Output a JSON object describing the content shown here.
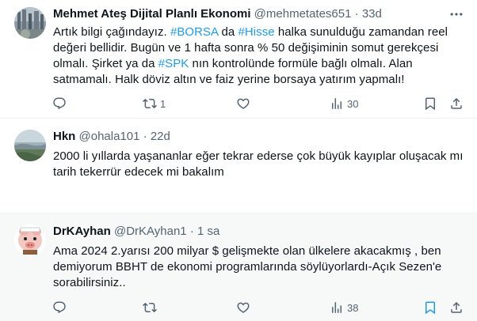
{
  "colors": {
    "accent": "#1d9bf0",
    "muted": "#536471",
    "text": "#0f1419",
    "highlight_bg": "#f7f9f9"
  },
  "tweets": [
    {
      "author": "Mehmet Ateş Dijital Planlı Ekonomi",
      "handle": "@mehmetates651",
      "separator": "·",
      "time": "33d",
      "body": [
        {
          "t": "Artık bilgi çağındayız. "
        },
        {
          "t": "#BORSA",
          "tag": true
        },
        {
          "t": " da "
        },
        {
          "t": "#Hisse",
          "tag": true
        },
        {
          "t": " halka sunulduğu zamandan reel değeri bellidir. Bugün ve 1 hafta sonra % 50 değişiminin somut gerekçesi olmalı. Şirket ya da "
        },
        {
          "t": "#SPK",
          "tag": true
        },
        {
          "t": " nın kontrolünde formüle bağlı olmalı. Alan satmamalı. Halk döviz altın ve faiz yerine borsaya yatırım yapmalı!"
        }
      ],
      "replies": "",
      "reposts": "1",
      "likes": "",
      "views": "30"
    },
    {
      "author": "Hkn",
      "handle": "@ohala101",
      "separator": "·",
      "time": "22d",
      "body": [
        {
          "t": "2000 li yıllarda yaşananlar eğer tekrar ederse çok büyük kayıplar oluşacak mı tarih tekerrür edecek mi bakalım"
        }
      ],
      "replies": "",
      "reposts": "",
      "likes": "",
      "views": ""
    },
    {
      "author": "DrKAyhan",
      "handle": "@DrKAyhan1",
      "separator": "·",
      "time": "1 sa",
      "body": [
        {
          "t": "Ama 2024 2.yarısı 200 milyar $ gelişmekte olan ülkelere akacakmış , ben demiyorum BBHT de ekonomi programlarında söylüyorlardı-Açık Sezen'e sorabilirsiniz.."
        }
      ],
      "replies": "",
      "reposts": "",
      "likes": "",
      "views": "38"
    }
  ]
}
